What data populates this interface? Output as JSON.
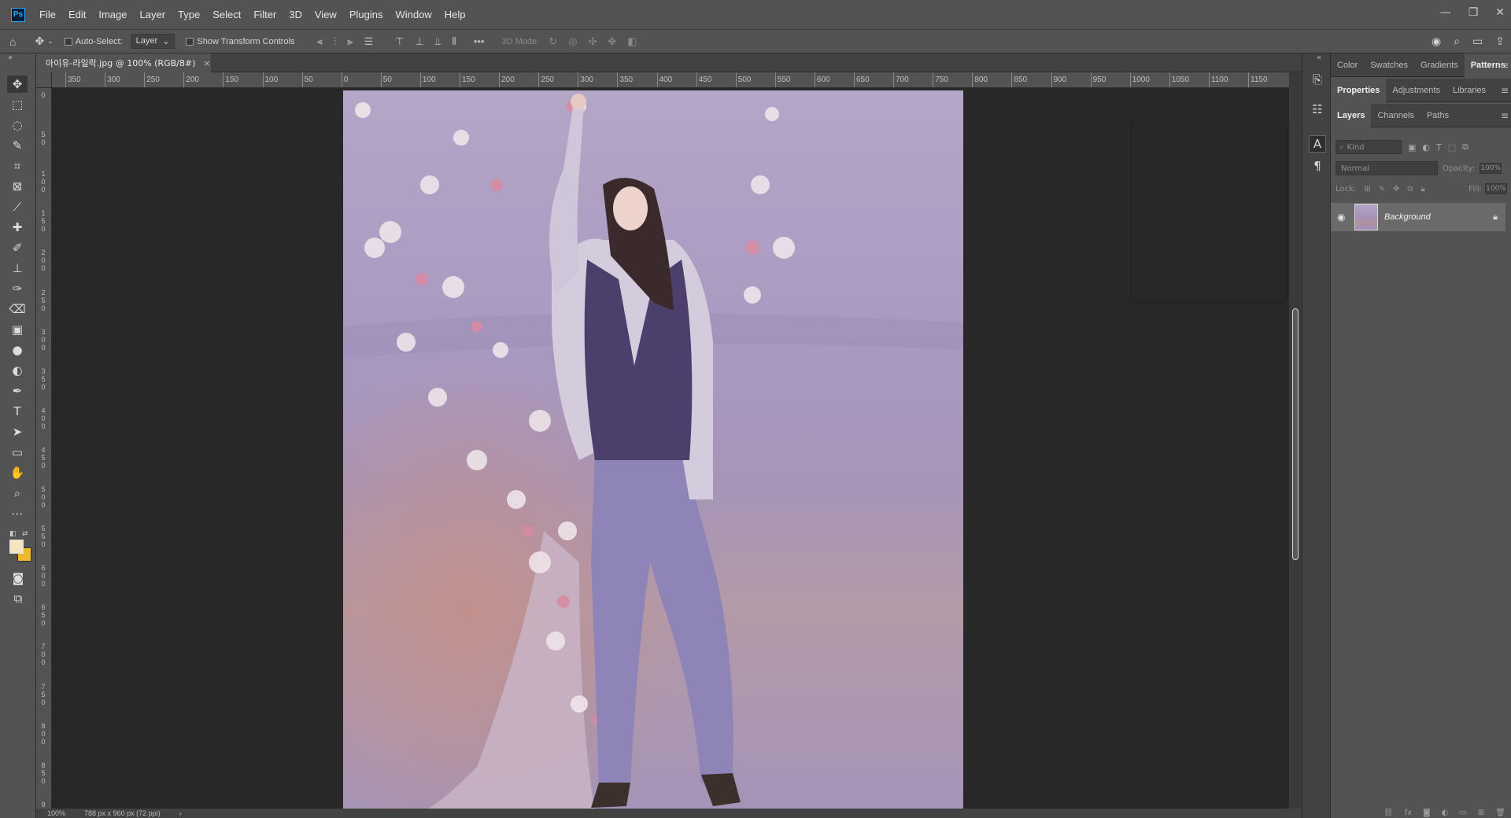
{
  "app": {
    "logo": "Ps",
    "menu": [
      "File",
      "Edit",
      "Image",
      "Layer",
      "Type",
      "Select",
      "Filter",
      "3D",
      "View",
      "Plugins",
      "Window",
      "Help"
    ],
    "window_controls": [
      "—",
      "❐",
      "✕"
    ]
  },
  "options_bar": {
    "auto_select_label": "Auto-Select:",
    "auto_select_target": "Layer",
    "show_transform_label": "Show Transform Controls",
    "more_label": "•••",
    "mode_3d_label": "3D Mode:"
  },
  "document": {
    "tab_title": "아이유-라일락.jpg @ 100% (RGB/8#)",
    "close_glyph": "×"
  },
  "ruler": {
    "top_labels": [
      "350",
      "300",
      "250",
      "200",
      "150",
      "100",
      "50",
      "0",
      "50",
      "100",
      "150",
      "200",
      "250",
      "300",
      "350",
      "400",
      "450",
      "500",
      "550",
      "600",
      "650",
      "700",
      "750",
      "800",
      "850",
      "900",
      "950",
      "1000",
      "1050",
      "1100",
      "1150"
    ],
    "left_labels": [
      "0",
      "5 0",
      "1 0 0",
      "1 5 0",
      "2 0 0",
      "2 5 0",
      "3 0 0",
      "3 5 0",
      "4 0 0",
      "4 5 0",
      "5 0 0",
      "5 5 0",
      "6 0 0",
      "6 5 0",
      "7 0 0",
      "7 5 0",
      "8 0 0",
      "8 5 0",
      "9"
    ]
  },
  "status": {
    "zoom": "100%",
    "doc_size": "788 px x 960 px (72 ppi)",
    "arrow": "›"
  },
  "panels": {
    "row1_tabs": [
      "Color",
      "Swatches",
      "Gradients",
      "Patterns"
    ],
    "row1_active": "Patterns",
    "row2_tabs": [
      "Properties",
      "Adjustments",
      "Libraries"
    ],
    "row2_active": "Properties",
    "row3_tabs": [
      "Layers",
      "Channels",
      "Paths"
    ],
    "row3_active": "Layers",
    "kind_placeholder": "Kind",
    "blend_mode": "Normal",
    "opacity_label": "Opacity:",
    "opacity_value": "100%",
    "lock_label": "Lock:",
    "fill_label": "Fill:",
    "fill_value": "100%",
    "layers": [
      {
        "name": "Background",
        "visible": true,
        "locked": true
      }
    ]
  },
  "colors": {
    "foreground": "#f6e6bf",
    "background": "#f0b82c",
    "accent": "#31a8ff"
  }
}
